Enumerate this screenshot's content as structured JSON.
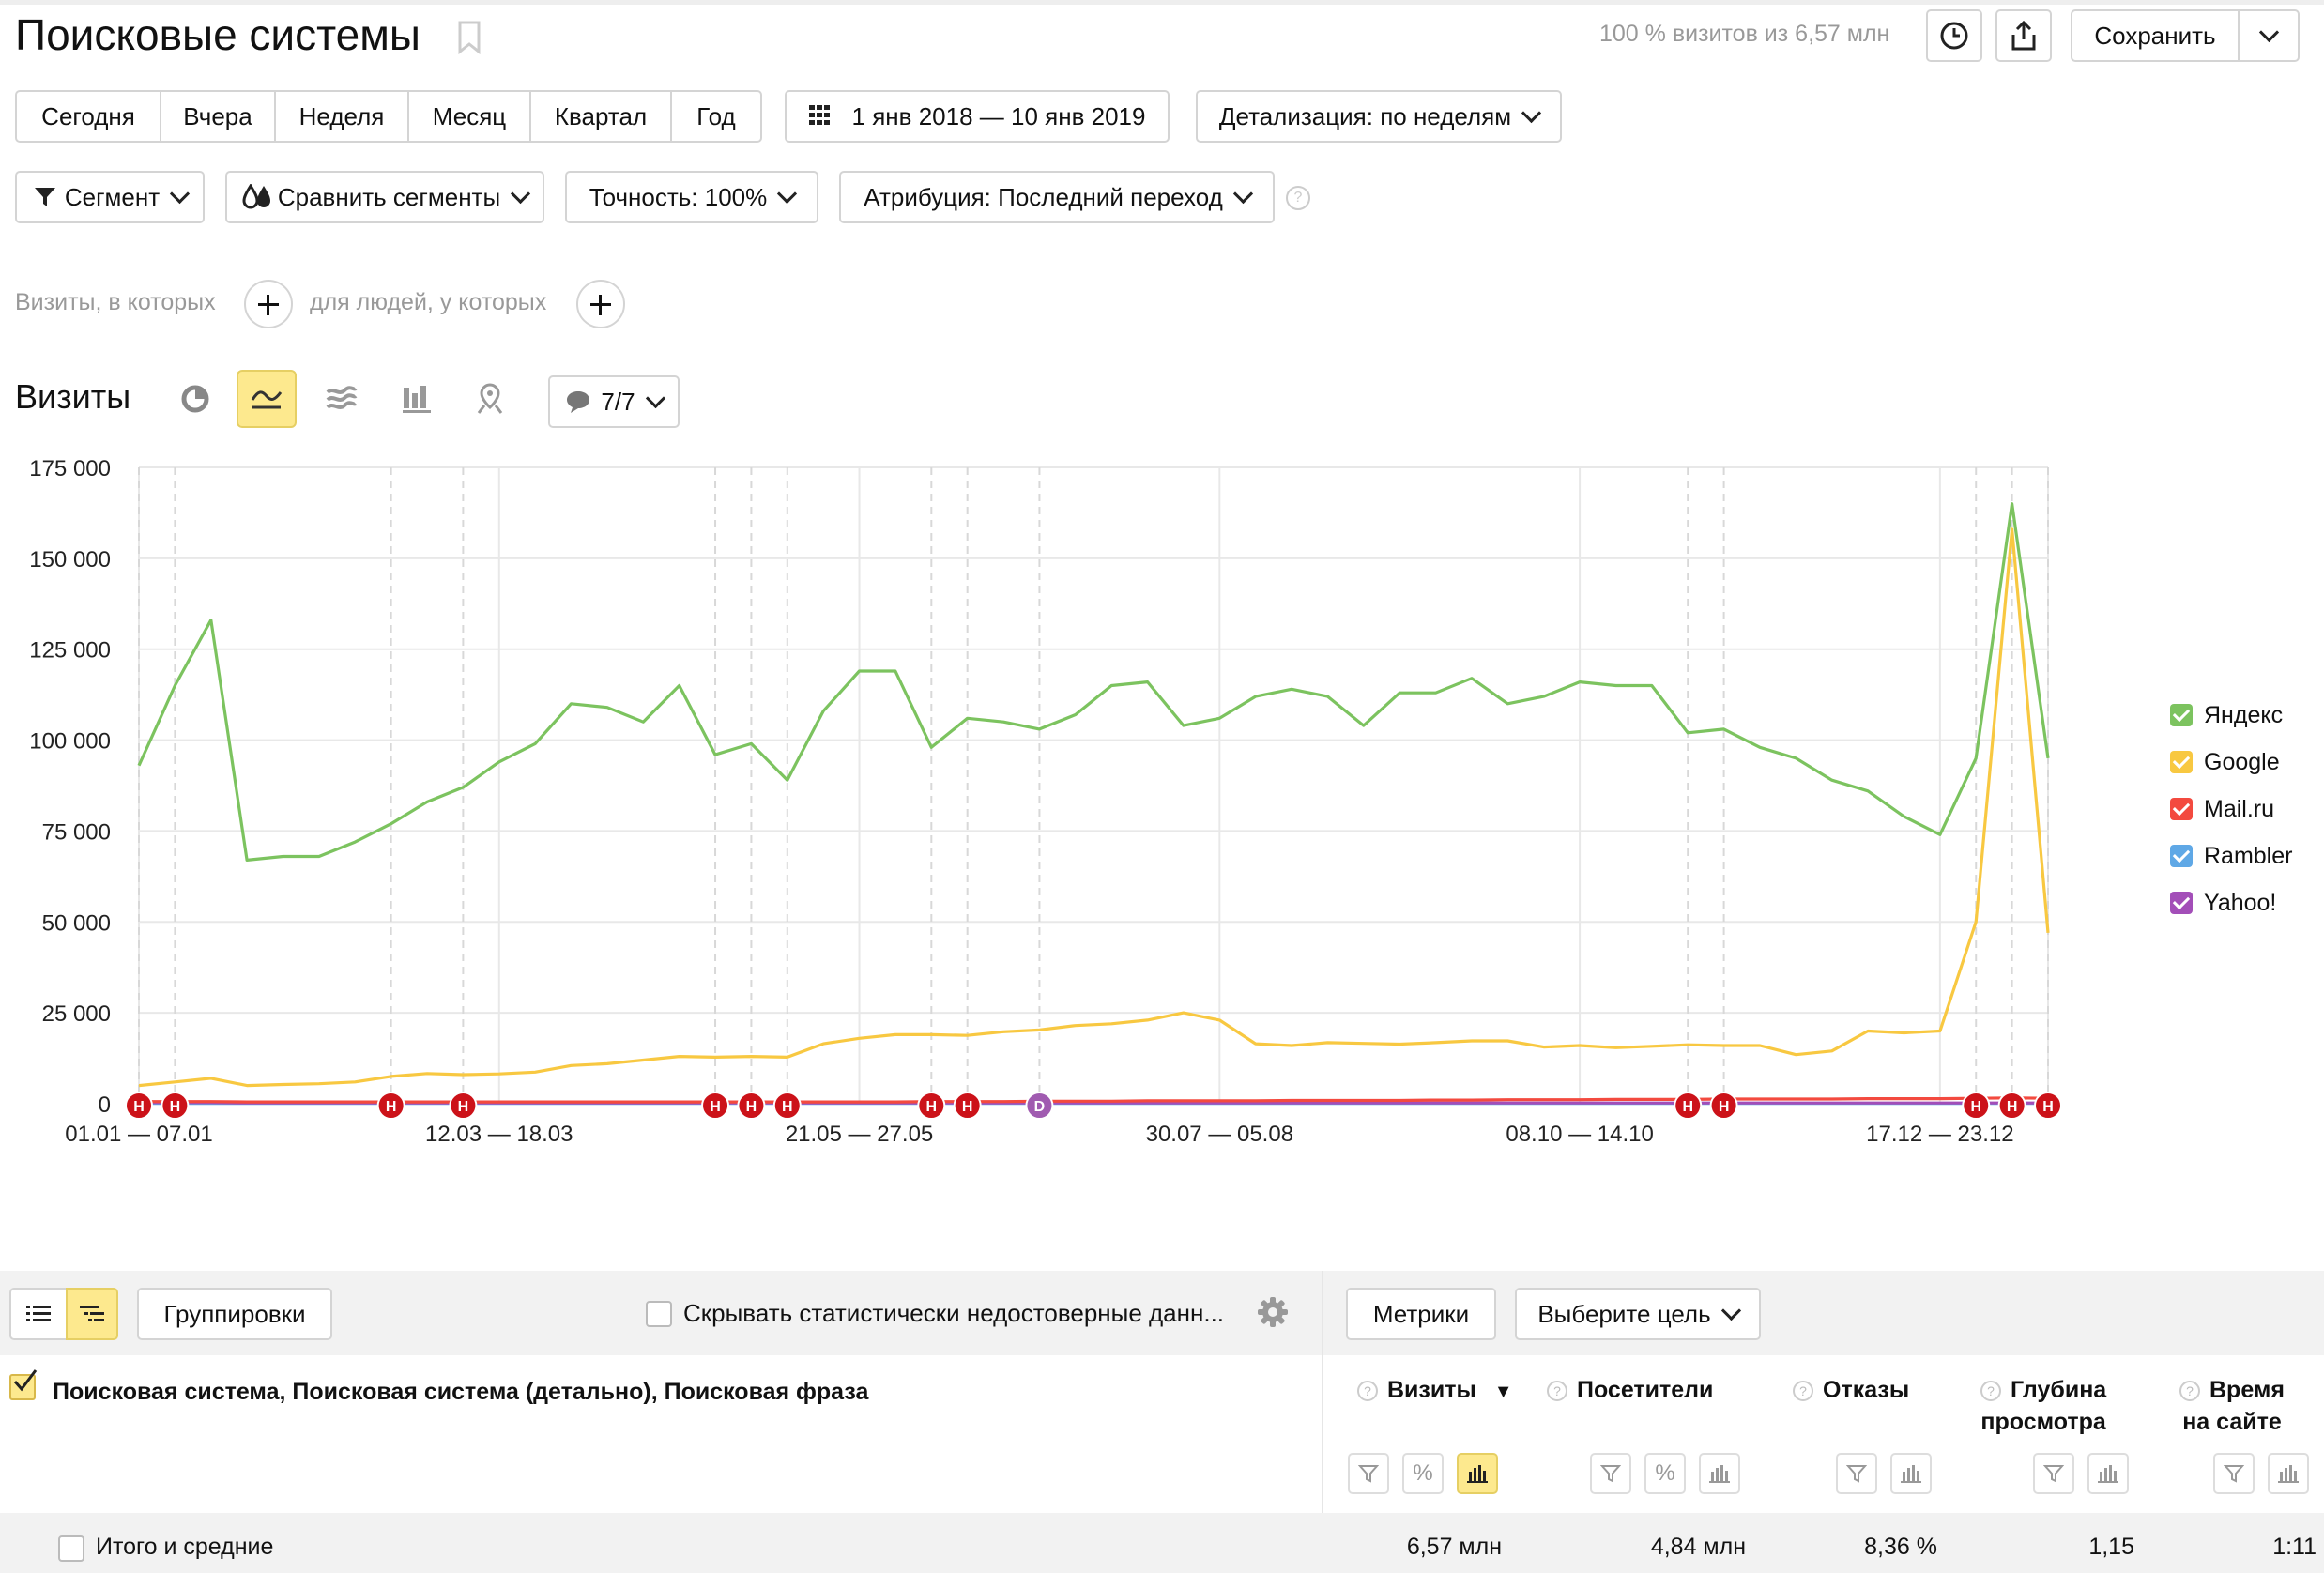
{
  "header": {
    "title": "Поисковые системы",
    "visits_info": "100 % визитов из 6,57 млн",
    "save_label": "Сохранить"
  },
  "periods": [
    "Сегодня",
    "Вчера",
    "Неделя",
    "Месяц",
    "Квартал",
    "Год"
  ],
  "date_range": "1 янв 2018 — 10 янв 2019",
  "detail_label": "Детализация: по неделям",
  "filters": {
    "segment": "Сегмент",
    "compare": "Сравнить сегменты",
    "accuracy": "Точность: 100%",
    "attribution": "Атрибуция: Последний переход"
  },
  "conditions": {
    "visits_where": "Визиты, в которых",
    "people_where": "для людей, у которых"
  },
  "chart_section": {
    "title": "Визиты",
    "series_count": "7/7"
  },
  "chart_data": {
    "type": "line",
    "y_ticks": [
      "175 000",
      "150 000",
      "125 000",
      "100 000",
      "75 000",
      "50 000",
      "25 000",
      "0"
    ],
    "ylim": [
      0,
      175000
    ],
    "x_ticks": [
      {
        "label": "01.01 — 07.01",
        "week": 0
      },
      {
        "label": "12.03 — 18.03",
        "week": 10
      },
      {
        "label": "21.05 — 27.05",
        "week": 20
      },
      {
        "label": "30.07 — 05.08",
        "week": 30
      },
      {
        "label": "08.10 — 14.10",
        "week": 40
      },
      {
        "label": "17.12 — 23.12",
        "week": 50
      }
    ],
    "weeks": 54,
    "series": [
      {
        "name": "Яндекс",
        "color": "#7cc35f",
        "values": [
          93000,
          115000,
          133000,
          67000,
          68000,
          68000,
          72000,
          77000,
          83000,
          87000,
          94000,
          99000,
          110000,
          109000,
          105000,
          115000,
          96000,
          99000,
          89000,
          108000,
          119000,
          119000,
          98000,
          106000,
          105000,
          103000,
          107000,
          115000,
          116000,
          104000,
          106000,
          112000,
          114000,
          112000,
          104000,
          113000,
          113000,
          117000,
          110000,
          112000,
          116000,
          115000,
          115000,
          102000,
          103000,
          98000,
          95000,
          89000,
          86000,
          79000,
          74000,
          95000,
          165000,
          95000
        ]
      },
      {
        "name": "Google",
        "color": "#f8c841",
        "values": [
          5000,
          6000,
          7000,
          5000,
          5300,
          5500,
          6000,
          7500,
          8300,
          8000,
          8200,
          8700,
          10500,
          11000,
          12000,
          13000,
          12800,
          13000,
          12800,
          16500,
          18000,
          19000,
          19000,
          18800,
          19800,
          20300,
          21500,
          22000,
          23000,
          25000,
          23000,
          16500,
          16000,
          16800,
          16600,
          16400,
          16800,
          17300,
          17300,
          15600,
          16000,
          15400,
          15800,
          16200,
          16000,
          16000,
          13500,
          14500,
          20000,
          19500,
          20000,
          50000,
          158000,
          47000
        ]
      },
      {
        "name": "Mail.ru",
        "color": "#f34a3f",
        "values": [
          600,
          600,
          600,
          500,
          500,
          500,
          500,
          500,
          500,
          500,
          500,
          500,
          500,
          500,
          500,
          500,
          500,
          500,
          500,
          500,
          500,
          500,
          600,
          600,
          600,
          700,
          700,
          700,
          800,
          800,
          800,
          800,
          900,
          900,
          900,
          900,
          1000,
          1000,
          1100,
          1100,
          1100,
          1200,
          1200,
          1200,
          1300,
          1300,
          1300,
          1300,
          1400,
          1400,
          1400,
          1500,
          1600,
          1500
        ]
      },
      {
        "name": "Rambler",
        "color": "#5fa8e6",
        "values": [
          100,
          100,
          100,
          100,
          100,
          100,
          100,
          100,
          100,
          100,
          100,
          100,
          100,
          100,
          100,
          100,
          100,
          100,
          100,
          100,
          100,
          100,
          100,
          100,
          100,
          100,
          100,
          100,
          100,
          100,
          100,
          100,
          100,
          100,
          100,
          100,
          100,
          100,
          100,
          100,
          100,
          100,
          100,
          100,
          100,
          100,
          100,
          100,
          100,
          100,
          100,
          100,
          100,
          100
        ]
      },
      {
        "name": "Yahoo!",
        "color": "#a34eb8",
        "values": [
          300,
          300,
          300,
          200,
          200,
          200,
          200,
          200,
          200,
          200,
          200,
          200,
          200,
          200,
          200,
          200,
          200,
          200,
          200,
          200,
          200,
          200,
          200,
          200,
          200,
          200,
          200,
          200,
          200,
          200,
          200,
          200,
          200,
          200,
          200,
          200,
          200,
          200,
          200,
          200,
          200,
          200,
          200,
          200,
          200,
          200,
          200,
          200,
          200,
          200,
          200,
          200,
          200,
          200
        ]
      }
    ],
    "annotations": [
      {
        "label": "Н",
        "week": 0
      },
      {
        "label": "Н",
        "week": 1
      },
      {
        "label": "Н",
        "week": 7
      },
      {
        "label": "Н",
        "week": 9
      },
      {
        "label": "Н",
        "week": 16
      },
      {
        "label": "Н",
        "week": 17
      },
      {
        "label": "Н",
        "week": 18
      },
      {
        "label": "Н",
        "week": 22
      },
      {
        "label": "Н",
        "week": 23
      },
      {
        "label": "D",
        "week": 25
      },
      {
        "label": "Н",
        "week": 43
      },
      {
        "label": "Н",
        "week": 44
      },
      {
        "label": "Н",
        "week": 51
      },
      {
        "label": "Н",
        "week": 52
      },
      {
        "label": "Н",
        "week": 53
      }
    ]
  },
  "toolbar2": {
    "groupings": "Группировки",
    "hide_unreliable": "Скрывать статистически недостоверные данн...",
    "metrics": "Метрики",
    "choose_goal": "Выберите цель"
  },
  "table": {
    "dimension": "Поисковая система, Поисковая система (детально), Поисковая фраза",
    "columns": [
      {
        "label": "Визиты",
        "sorted": "▼"
      },
      {
        "label": "Посетители"
      },
      {
        "label": "Отказы"
      },
      {
        "label_1": "Глубина",
        "label_2": "просмотра"
      },
      {
        "label_1": "Время",
        "label_2": "на сайте"
      }
    ],
    "totals_label": "Итого и средние",
    "totals": [
      "6,57 млн",
      "4,84 млн",
      "8,36 %",
      "1,15",
      "1:11"
    ]
  }
}
